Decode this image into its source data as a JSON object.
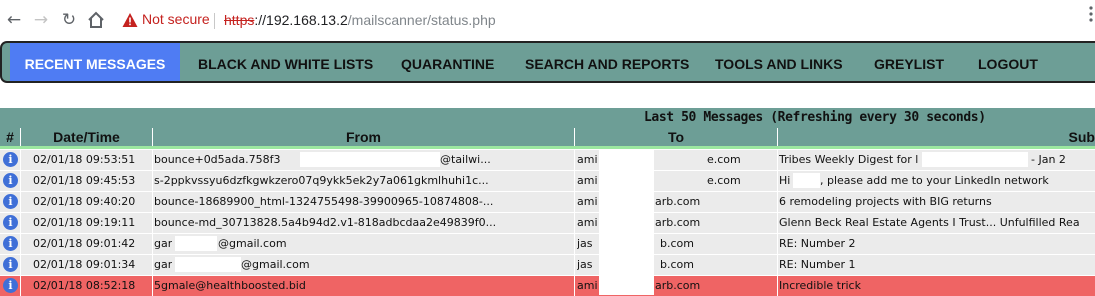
{
  "browser": {
    "security_label": "Not secure",
    "url_scheme": "https",
    "url_host": "://192.168.13.2",
    "url_path": "/mailscanner/status.php",
    "icons": {
      "back": "back-arrow-icon",
      "forward": "forward-arrow-icon",
      "reload": "reload-icon",
      "home": "home-icon",
      "warning": "warning-icon",
      "menu": "kebab-menu-icon"
    },
    "colors": {
      "warning": "#c5221f"
    }
  },
  "nav": {
    "items": [
      {
        "label": "RECENT MESSAGES",
        "active": true
      },
      {
        "label": "BLACK AND WHITE LISTS"
      },
      {
        "label": "QUARANTINE"
      },
      {
        "label": "SEARCH AND REPORTS"
      },
      {
        "label": "TOOLS AND LINKS"
      },
      {
        "label": "GREYLIST"
      },
      {
        "label": "LOGOUT"
      }
    ],
    "colors": {
      "bar": "#6d9e96",
      "active": "#4f7cf3"
    }
  },
  "table": {
    "title": "Last 50 Messages (Refreshing every 30 seconds)",
    "columns": [
      "#",
      "Date/Time",
      "From",
      "To",
      "Sub"
    ],
    "rows": [
      {
        "datetime": "02/01/18 09:53:51",
        "from": "bounce+0d5ada.758f3",
        "from_tail": "@tailwi...",
        "to": "ami",
        "to_tail": "e.com",
        "subject": "Tribes Weekly Digest for l",
        "subject_tail": "- Jan 2",
        "spam": false
      },
      {
        "datetime": "02/01/18 09:45:53",
        "from": "s-2ppkvssyu6dzfkgwkzero07q9ykk5ek2y7a061gkmlhuhi1c...",
        "to": "ami",
        "to_tail": "e.com",
        "subject": "Hi",
        "subject_tail": ", please add me to your LinkedIn network",
        "spam": false
      },
      {
        "datetime": "02/01/18 09:40:20",
        "from": "bounce-18689900_html-1324755498-39900965-10874808-...",
        "to": "ami",
        "to_tail": "arb.com",
        "subject": "6 remodeling projects with BIG returns",
        "spam": false
      },
      {
        "datetime": "02/01/18 09:19:11",
        "from": "bounce-md_30713828.5a4b94d2.v1-818adbcdaa2e49839f0...",
        "to": "ami",
        "to_tail": "arb.com",
        "subject": "Glenn Beck Real Estate Agents I Trust... Unfulfilled Rea",
        "spam": false
      },
      {
        "datetime": "02/01/18 09:01:42",
        "from": "gar",
        "from_tail": "@gmail.com",
        "to": "jas",
        "to_tail": "b.com",
        "subject": "RE: Number 2",
        "spam": false
      },
      {
        "datetime": "02/01/18 09:01:34",
        "from": "gar",
        "from_tail": "@gmail.com",
        "to": "jas",
        "to_tail": "b.com",
        "subject": "RE: Number 1",
        "spam": false
      },
      {
        "datetime": "02/01/18 08:52:18",
        "from": "5gmale@healthboosted.bid",
        "to": "ami",
        "to_tail": "arb.com",
        "subject": "Incredible trick",
        "spam": true
      }
    ],
    "colors": {
      "header": "#6d9e96",
      "row": "#ebebeb",
      "spam_row": "#ef6464",
      "info_icon": "#3f6fd7",
      "separator": "#9be7a0"
    },
    "row_icon": "info-icon"
  }
}
